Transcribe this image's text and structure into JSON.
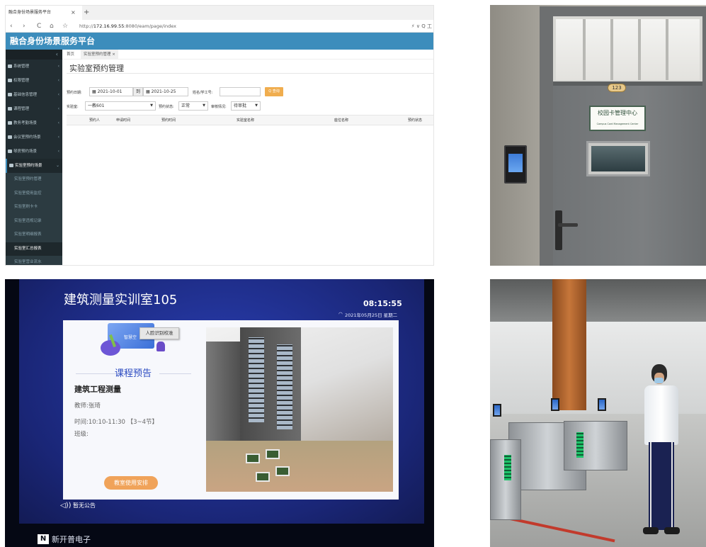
{
  "panel1": {
    "tab_title": "融合身份场景服务平台",
    "tab_close": "×",
    "tab_new": "+",
    "nav_back": "‹",
    "nav_forward": "›",
    "nav_reload": "C",
    "nav_home": "⌂",
    "nav_star": "☆",
    "url_prefix": "http://",
    "url_host": "172.16.99.55",
    "url_path": ":8080/eam/page/index",
    "addr_tools": "⚡ ∨   Q 工",
    "app_title": "融合身份场景服务平台",
    "sidebar_toggle": "‹",
    "sidebar_items": [
      "系统管理",
      "权限管理",
      "基础信息管理",
      "课程管理",
      "教务考勤场景",
      "会议室预约场景",
      "琴房预约场景",
      "实验室预约场景"
    ],
    "sidebar_subitems": [
      "实验室预约管理",
      "实验室使用监控",
      "实验室刷卡卡",
      "实验室违规记录",
      "实验室明细报表",
      "实验室汇总报表",
      "实验室营业流水"
    ],
    "active_subitem_index": 5,
    "crumb_home": "首页",
    "crumb_current": "实验室预约管理 ×",
    "page_title": "实验室预约管理",
    "filters": {
      "date_label": "预约日期:",
      "date_from": "2021-10-01",
      "date_to_sep": "到",
      "date_to": "2021-10-25",
      "name_label": "姓名/学工号:",
      "name_value": "",
      "search_button": "Q 查询",
      "lab_label": "实验室:",
      "lab_value": "一教601",
      "status_label": "预约状态:",
      "status_value": "正常",
      "review_label": "审核情况:",
      "review_value": "待审批"
    },
    "columns": [
      "预约人",
      "申请时间",
      "预约时间",
      "实验室名称",
      "座位名称",
      "预约状态"
    ]
  },
  "panel2": {
    "room_number": "123",
    "sign_cn": "校园卡管理中心",
    "sign_en": "Campus Card Management Center"
  },
  "panel3": {
    "room_title": "建筑测量实训室105",
    "clock": "08:15:55",
    "date": "2021年05月25日 星期二",
    "wifi_icon": "◠",
    "illus_label": "智慧空",
    "face_tag": "人脸识别校准",
    "preview_heading": "课程预告",
    "course_name": "建筑工程测量",
    "teacher": "教师:张琦",
    "time": "时间:10:10-11:30 【3~4节】",
    "class": "班级:",
    "usage_button": "教室使用安排",
    "notice_icon": "◁))",
    "notice": "暂无公告",
    "brand_mark": "N",
    "brand": "新开普电子"
  }
}
